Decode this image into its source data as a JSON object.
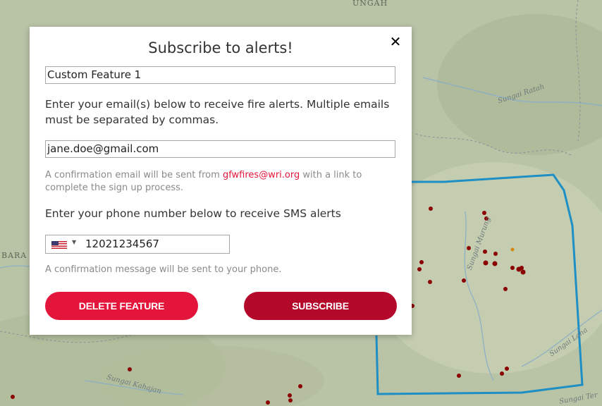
{
  "map": {
    "labels": {
      "top": "UNGAH",
      "left": "BARA",
      "river_1": "Sungai Ratah",
      "river_2": "Sungai Murung",
      "river_3": "Sungai Kahajan",
      "river_4": "Sungai Laha",
      "river_5": "Sungai Ter"
    },
    "colors": {
      "base": "#b9c3a6",
      "boundary": "#1e8fc4",
      "fire": "#8b0000",
      "fire_alt": "#d4860b"
    }
  },
  "modal": {
    "title": "Subscribe to alerts!",
    "close_icon": "close-icon",
    "feature_name": {
      "value": "Custom Feature 1"
    },
    "email_instructions": "Enter your email(s) below to receive fire alerts. Multiple emails must be separated by commas.",
    "email": {
      "value": "jane.doe@gmail.com"
    },
    "email_hint": {
      "before": "A confirmation email will be sent from ",
      "link": "gfwfires@wri.org",
      "after": " with a link to complete the sign up process."
    },
    "phone_instructions": "Enter your phone number below to receive SMS alerts",
    "phone": {
      "country_icon": "us-flag-icon",
      "value": "12021234567"
    },
    "phone_hint": "A confirmation message will be sent to your phone.",
    "buttons": {
      "delete": "DELETE FEATURE",
      "subscribe": "SUBSCRIBE"
    },
    "colors": {
      "delete": "#e3153b",
      "subscribe": "#b4092b",
      "link": "#e3153b"
    }
  }
}
